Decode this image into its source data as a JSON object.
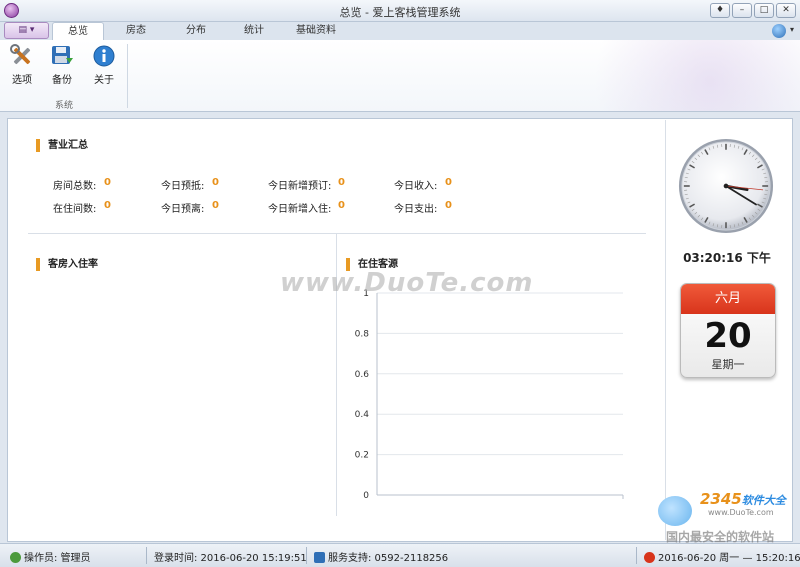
{
  "window": {
    "title": "总览 - 爱上客栈管理系统"
  },
  "app_menu_label": "",
  "tabs": [
    {
      "label": "总览",
      "active": true
    },
    {
      "label": "房态",
      "active": false
    },
    {
      "label": "分布",
      "active": false
    },
    {
      "label": "统计",
      "active": false
    },
    {
      "label": "基础资料",
      "active": false
    }
  ],
  "ribbon": {
    "buttons": [
      {
        "label": "选项",
        "icon": "tools-icon"
      },
      {
        "label": "备份",
        "icon": "backup-icon"
      },
      {
        "label": "关于",
        "icon": "info-icon"
      }
    ],
    "group_label": "系统"
  },
  "summary": {
    "title": "营业汇总",
    "row1": [
      {
        "label": "房间总数:",
        "value": "0"
      },
      {
        "label": "今日预抵:",
        "value": "0"
      },
      {
        "label": "今日新增预订:",
        "value": "0"
      },
      {
        "label": "今日收入:",
        "value": "0"
      }
    ],
    "row2": [
      {
        "label": "在住间数:",
        "value": "0"
      },
      {
        "label": "今日预离:",
        "value": "0"
      },
      {
        "label": "今日新增入住:",
        "value": "0"
      },
      {
        "label": "今日支出:",
        "value": "0"
      }
    ]
  },
  "occupancy": {
    "title": "客房入住率"
  },
  "guests": {
    "title": "在住客源"
  },
  "chart_data": {
    "type": "bar",
    "title": "",
    "xlabel": "",
    "ylabel": "",
    "categories": [],
    "values": [],
    "ylim": [
      0,
      1
    ],
    "yticks": [
      "0",
      "0.2",
      "0.4",
      "0.6",
      "0.8",
      "1"
    ],
    "grid": true
  },
  "clock": {
    "time": "03:20:16 下午",
    "hour": 3,
    "minute": 20,
    "second": 16
  },
  "calendar": {
    "month": "六月",
    "day": "20",
    "weekday": "星期一"
  },
  "watermark": {
    "center": "www.DuoTe.com",
    "logo_main": "2345",
    "logo_sub": "软件大全",
    "url": "www.DuoTe.com",
    "caption": "国内最安全的软件站"
  },
  "status": {
    "operator": "操作员: 管理员",
    "login_time": "登录时间: 2016-06-20 15:19:51",
    "support": "服务支持: 0592-2118256",
    "now": "2016-06-20 周一 — 15:20:16"
  },
  "colors": {
    "accent": "#e89a23",
    "value": "#e8911a",
    "calendar_header": "#e2452a"
  }
}
